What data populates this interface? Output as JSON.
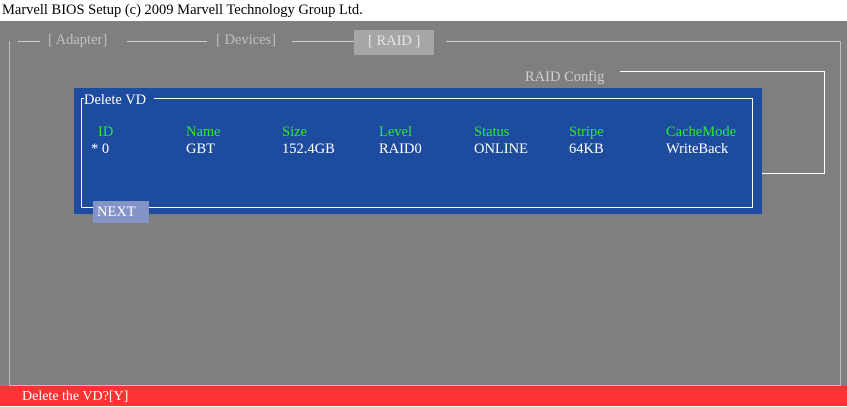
{
  "window": {
    "title": "Marvell BIOS Setup (c) 2009 Marvell Technology Group Ltd."
  },
  "tabs": [
    {
      "label": "[ Adapter]"
    },
    {
      "label": "[ Devices]"
    },
    {
      "label": "[  RAID  ]",
      "active": true
    }
  ],
  "raid_config": {
    "label": "RAID Config"
  },
  "dialog": {
    "title": "Delete VD",
    "columns": [
      "ID",
      "Name",
      "Size",
      "Level",
      "Status",
      "Stripe",
      "CacheMode"
    ],
    "rows": [
      {
        "id": "* 0",
        "name": "GBT",
        "size": "152.4GB",
        "level": "RAID0",
        "status": "ONLINE",
        "stripe": "64KB",
        "cache": "WriteBack"
      }
    ],
    "next_label": "NEXT"
  },
  "status": {
    "text": "Delete the VD?[Y]"
  },
  "colors": {
    "screen_bg": "#7f7f7f",
    "dialog_bg": "#1d4b9e",
    "header_text": "#2ee82e",
    "status_bar": "#ff3333"
  }
}
